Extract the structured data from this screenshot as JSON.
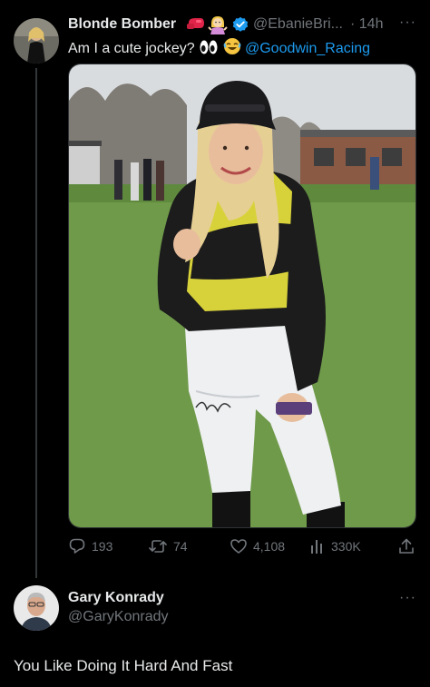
{
  "tweet": {
    "display_name": "Blonde Bomber",
    "name_emojis": [
      "boxing-glove-emoji",
      "woman-shrugging-emoji"
    ],
    "handle": "@EbanieBri...",
    "time": "· 14h",
    "more": "···",
    "text_before": "Am I a cute jockey?",
    "text_emojis": [
      "eyes-emoji",
      "laughing-emoji"
    ],
    "mention": "@Goodwin_Racing",
    "image_description_icon": "photo-jockey",
    "stats": {
      "replies": "193",
      "retweets": "74",
      "likes": "4,108",
      "views": "330K"
    }
  },
  "reply": {
    "display_name": "Gary Konrady",
    "handle": "@GaryKonrady",
    "more": "···",
    "text": "You Like Doing It Hard And Fast"
  },
  "colors": {
    "background": "#000000",
    "primary_text": "#e7e9ea",
    "secondary_text": "#71767b",
    "accent": "#1d9bf0",
    "thread_line": "#333639"
  }
}
